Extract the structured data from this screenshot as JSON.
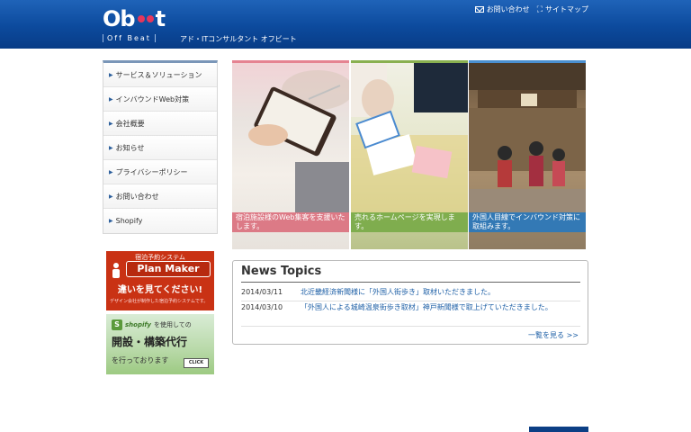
{
  "header": {
    "logo_main": "Ob",
    "logo_end": "t",
    "brand_sub": "Off Beat",
    "tagline": "アド・ITコンサルタント オフビート",
    "contact_link": "お問い合わせ",
    "sitemap_link": "サイトマップ",
    "bg_color": "#0c4a9d"
  },
  "nav": {
    "items": [
      {
        "label": "サービス＆ソリューション"
      },
      {
        "label": "インバウンドWeb対策"
      },
      {
        "label": "会社概要"
      },
      {
        "label": "お知らせ"
      },
      {
        "label": "プライバシーポリシー"
      },
      {
        "label": "お問い合わせ"
      },
      {
        "label": "Shopify"
      }
    ]
  },
  "banners": {
    "planmaker": {
      "line1": "宿泊予約システム",
      "logo": "Plan Maker",
      "headline": "違いを見てください!",
      "note": "デザイン会社が制作した宿泊予約システムです。"
    },
    "shopify": {
      "brand": "shopify",
      "prefix": "を使用しての",
      "headline": "開設・構築代行",
      "footer": "を行っております",
      "click": "CLICK"
    }
  },
  "hero": [
    {
      "caption": "宿泊施設様のWeb集客を支援いたします。"
    },
    {
      "caption": "売れるホームページを実現します。"
    },
    {
      "caption": "外国人目線でインバウンド対策に取組みます。"
    }
  ],
  "news": {
    "title": "News Topics",
    "items": [
      {
        "date": "2014/03/11",
        "text": "北近畿経済新聞様に「外国人街歩き」取材いただきました。"
      },
      {
        "date": "2014/03/10",
        "text": "「外国人による城崎温泉街歩き取材」神戸新聞様で取上げていただきました。"
      }
    ],
    "more": "一覧を見る >>"
  }
}
